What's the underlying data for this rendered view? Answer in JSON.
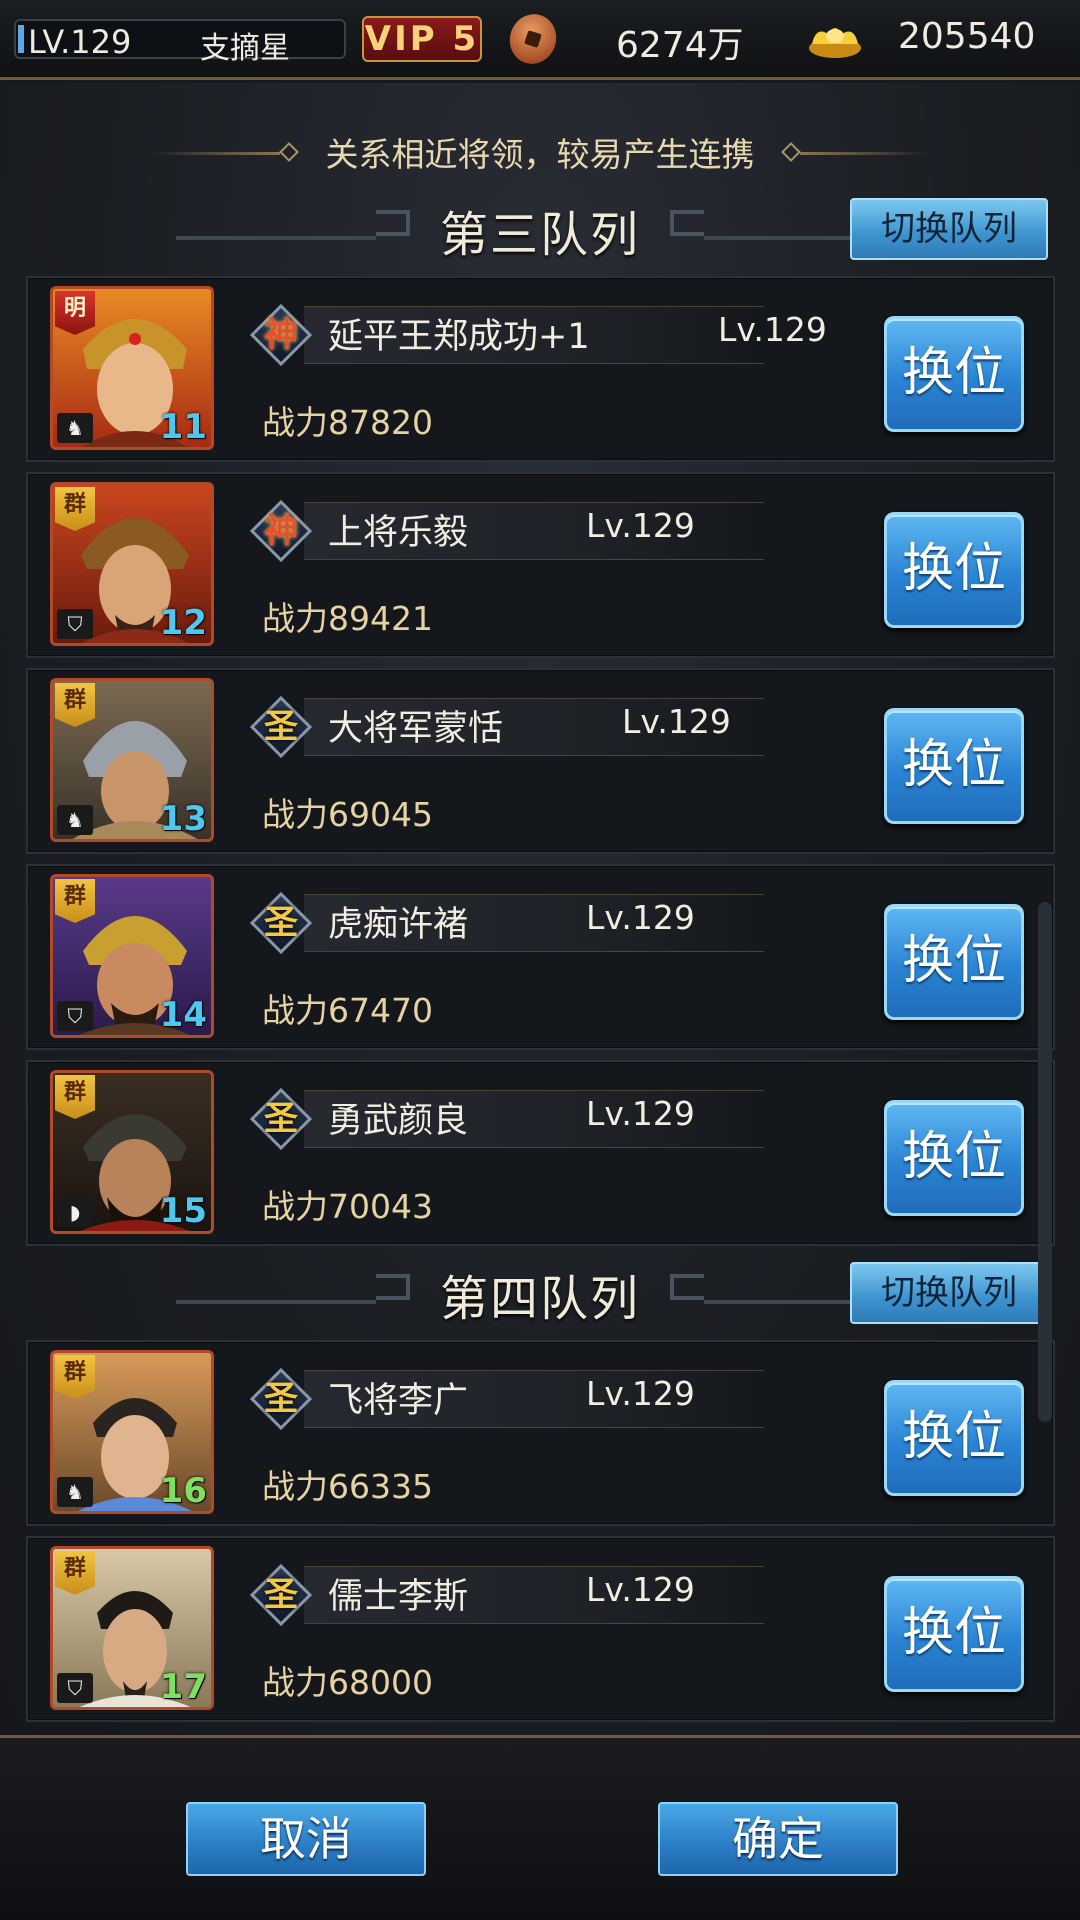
{
  "topbar": {
    "level": "LV.129",
    "nickname": "支摘星",
    "vip": "VIP 5",
    "coins": "6274万",
    "gold": "205540"
  },
  "hint": "关系相近将领，较易产生连携",
  "queues": [
    {
      "title": "第三队列",
      "switch_label": "切换队列",
      "generals": [
        {
          "faction": "明",
          "rank": "神",
          "name": "延平王郑成功+1",
          "level": "Lv.129",
          "power": "战力87820",
          "slot": "11"
        },
        {
          "faction": "群",
          "rank": "神",
          "name": "上将乐毅",
          "level": "Lv.129",
          "power": "战力89421",
          "slot": "12"
        },
        {
          "faction": "群",
          "rank": "圣",
          "name": "大将军蒙恬",
          "level": "Lv.129",
          "power": "战力69045",
          "slot": "13"
        },
        {
          "faction": "群",
          "rank": "圣",
          "name": "虎痴许褚",
          "level": "Lv.129",
          "power": "战力67470",
          "slot": "14"
        },
        {
          "faction": "群",
          "rank": "圣",
          "name": "勇武颜良",
          "level": "Lv.129",
          "power": "战力70043",
          "slot": "15"
        }
      ]
    },
    {
      "title": "第四队列",
      "switch_label": "切换队列",
      "generals": [
        {
          "faction": "群",
          "rank": "圣",
          "name": "飞将李广",
          "level": "Lv.129",
          "power": "战力66335",
          "slot": "16"
        },
        {
          "faction": "群",
          "rank": "圣",
          "name": "儒士李斯",
          "level": "Lv.129",
          "power": "战力68000",
          "slot": "17"
        }
      ]
    }
  ],
  "swap_label": "换位",
  "footer": {
    "cancel_label": "取消",
    "confirm_label": "确定"
  }
}
